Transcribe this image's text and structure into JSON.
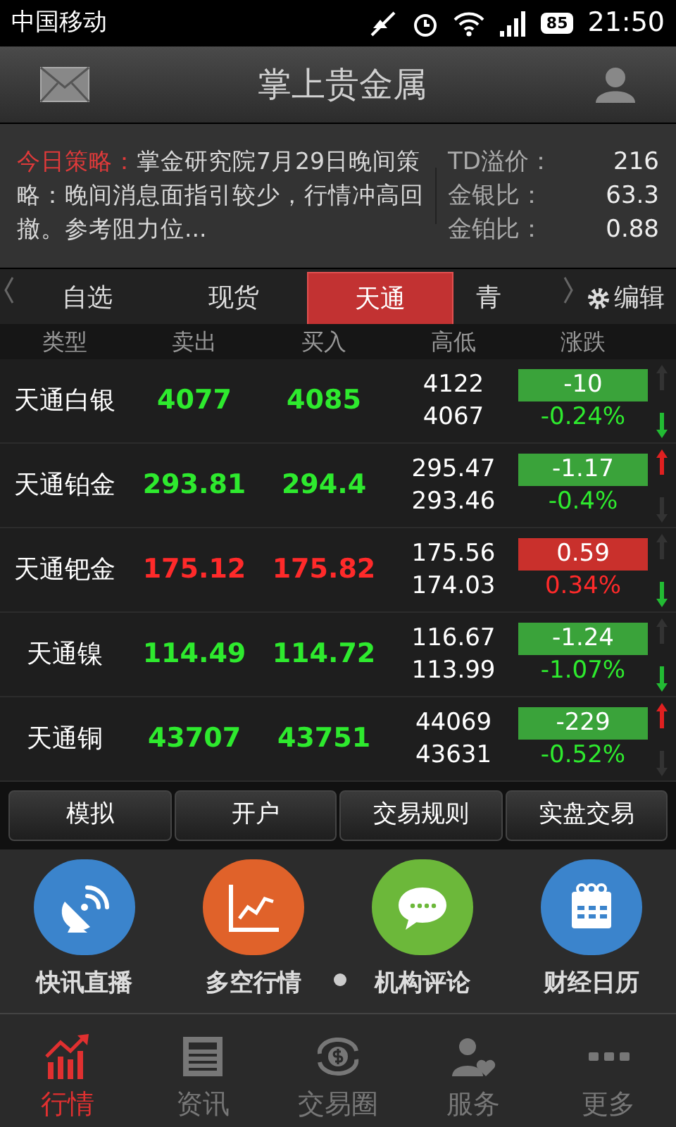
{
  "status_bar": {
    "carrier": "中国移动",
    "battery": "85",
    "time": "21:50"
  },
  "header": {
    "title": "掌上贵金属"
  },
  "strategy": {
    "label": "今日策略：",
    "text": "掌金研究院7月29日晚间策略：晚间消息面指引较少，行情冲高回撤。参考阻力位..."
  },
  "ratios": [
    {
      "label": "TD溢价：",
      "value": "216"
    },
    {
      "label": "金银比：",
      "value": "63.3"
    },
    {
      "label": "金铂比：",
      "value": "0.88"
    }
  ],
  "tabs": [
    {
      "label": "自选",
      "selected": false
    },
    {
      "label": "现货",
      "selected": false
    },
    {
      "label": "天通",
      "selected": true
    },
    {
      "label": "青",
      "selected": false
    }
  ],
  "edit_button": "编辑",
  "table": {
    "columns": [
      "类型",
      "卖出",
      "买入",
      "高低",
      "涨跌"
    ],
    "rows": [
      {
        "name": "天通白银",
        "sell": "4077",
        "buy": "4085",
        "high": "4122",
        "low": "4067",
        "change": "-10",
        "percent": "-0.24%",
        "rising": false,
        "arrow_up": false
      },
      {
        "name": "天通铂金",
        "sell": "293.81",
        "buy": "294.4",
        "high": "295.47",
        "low": "293.46",
        "change": "-1.17",
        "percent": "-0.4%",
        "rising": false,
        "arrow_up": true
      },
      {
        "name": "天通钯金",
        "sell": "175.12",
        "buy": "175.82",
        "high": "175.56",
        "low": "174.03",
        "change": "0.59",
        "percent": "0.34%",
        "rising": true,
        "arrow_up": false
      },
      {
        "name": "天通镍",
        "sell": "114.49",
        "buy": "114.72",
        "high": "116.67",
        "low": "113.99",
        "change": "-1.24",
        "percent": "-1.07%",
        "rising": false,
        "arrow_up": false
      },
      {
        "name": "天通铜",
        "sell": "43707",
        "buy": "43751",
        "high": "44069",
        "low": "43631",
        "change": "-229",
        "percent": "-0.52%",
        "rising": false,
        "arrow_up": true
      }
    ]
  },
  "action_buttons": [
    "模拟",
    "开户",
    "交易规则",
    "实盘交易"
  ],
  "shortcuts": [
    {
      "label": "快讯直播",
      "kind": "broadcast"
    },
    {
      "label": "多空行情",
      "kind": "chart"
    },
    {
      "label": "机构评论",
      "kind": "comment"
    },
    {
      "label": "财经日历",
      "kind": "calendar"
    }
  ],
  "bottom_nav": [
    {
      "label": "行情",
      "kind": "market",
      "selected": true
    },
    {
      "label": "资讯",
      "kind": "news",
      "selected": false
    },
    {
      "label": "交易圈",
      "kind": "exchange",
      "selected": false
    },
    {
      "label": "服务",
      "kind": "service",
      "selected": false
    },
    {
      "label": "更多",
      "kind": "more",
      "selected": false
    }
  ]
}
